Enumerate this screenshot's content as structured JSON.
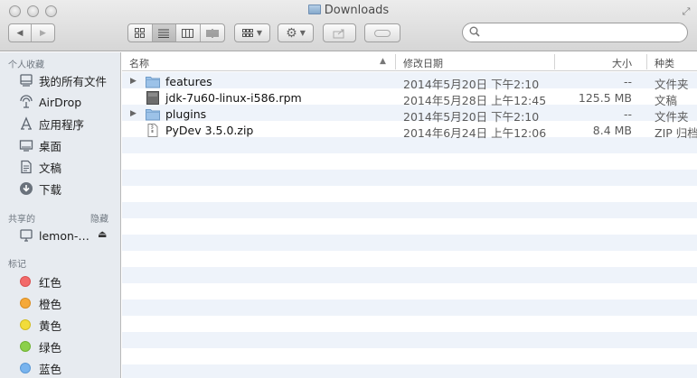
{
  "window": {
    "title": "Downloads"
  },
  "toolbar": {
    "back_label": "◀",
    "forward_label": "▶",
    "search_placeholder": ""
  },
  "sidebar": {
    "favorites_header": "个人收藏",
    "favorites": [
      {
        "label": "我的所有文件",
        "icon": "all-files-icon"
      },
      {
        "label": "AirDrop",
        "icon": "airdrop-icon"
      },
      {
        "label": "应用程序",
        "icon": "applications-icon"
      },
      {
        "label": "桌面",
        "icon": "desktop-icon"
      },
      {
        "label": "文稿",
        "icon": "documents-icon"
      },
      {
        "label": "下载",
        "icon": "downloads-icon"
      }
    ],
    "shared_header": "共享的",
    "shared_hide": "隐藏",
    "shared": [
      {
        "label": "lemon-…",
        "icon": "computer-icon"
      }
    ],
    "tags_header": "标记",
    "tags": [
      {
        "label": "红色",
        "color": "#f26a6a"
      },
      {
        "label": "橙色",
        "color": "#f5a93a"
      },
      {
        "label": "黄色",
        "color": "#f2dc3a"
      },
      {
        "label": "绿色",
        "color": "#8bd04a"
      },
      {
        "label": "蓝色",
        "color": "#79b4ee"
      }
    ]
  },
  "columns": {
    "name": "名称",
    "modified": "修改日期",
    "size": "大小",
    "kind": "种类"
  },
  "files": [
    {
      "name": "features",
      "modified": "2014年5月20日 下午2:10",
      "size": "--",
      "kind": "文件夹",
      "type": "folder",
      "expandable": true
    },
    {
      "name": "jdk-7u60-linux-i586.rpm",
      "modified": "2014年5月28日 上午12:45",
      "size": "125.5 MB",
      "kind": "文稿",
      "type": "rpm",
      "expandable": false
    },
    {
      "name": "plugins",
      "modified": "2014年5月20日 下午2:10",
      "size": "--",
      "kind": "文件夹",
      "type": "folder",
      "expandable": true
    },
    {
      "name": "PyDev 3.5.0.zip",
      "modified": "2014年6月24日 上午12:06",
      "size": "8.4 MB",
      "kind": "ZIP 归档",
      "type": "zip",
      "expandable": false
    }
  ]
}
